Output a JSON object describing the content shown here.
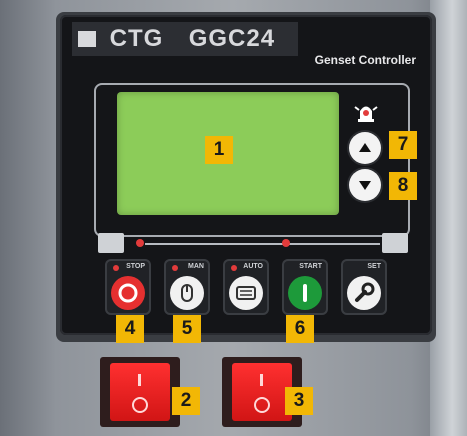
{
  "controller": {
    "brand": "CTG",
    "model": "GGC24",
    "subtitle": "Genset Controller"
  },
  "callouts": {
    "lcd": "1",
    "switch_left": "2",
    "switch_right": "3",
    "stop": "4",
    "manual": "5",
    "start": "6",
    "up": "7",
    "down": "8"
  },
  "keys": {
    "stop": "STOP",
    "manual": "MAN",
    "auto": "AUTO",
    "start": "START",
    "set": "SET"
  },
  "icons": {
    "alarm": "alarm-bell-icon",
    "up": "triangle-up-icon",
    "down": "triangle-down-icon",
    "generator": "generator-icon",
    "load": "load-icon",
    "stop": "stop-ring-icon",
    "manual": "hand-icon",
    "auto": "auto-mode-icon",
    "start": "start-bar-icon",
    "set": "wrench-icon"
  },
  "colors": {
    "lcd": "#8ccc59",
    "tag": "#f2b705",
    "stop": "#e53030",
    "start": "#1d9a3a",
    "switch": "#ff2a2a"
  }
}
